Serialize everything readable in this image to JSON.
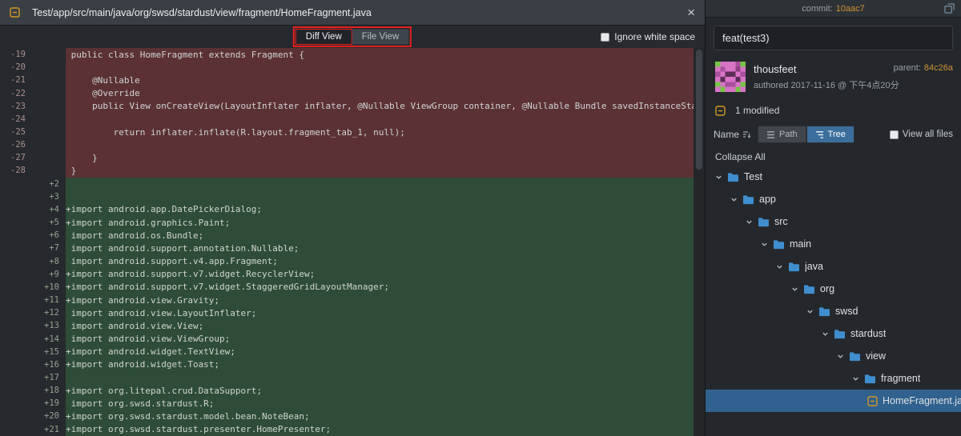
{
  "colors": {
    "header_bg": "#3a3f45",
    "panel_bg": "#26292d",
    "sidebar_bg": "#24282c",
    "sidebar_top_bg": "#2d3237",
    "del_bg": "#5b3134",
    "add_bg": "#2e4c37",
    "accent_blue": "#3f8ed0",
    "selected_blue": "#31618e",
    "hash_orange": "#cf9234",
    "mod_orange": "#d29922",
    "annotation_red": "#e5201d",
    "tree_btn_blue": "#3c6e9c"
  },
  "icons": {
    "modified_file_icon": "orange-square-with-dash",
    "close_icon": "×",
    "folder_icon": "blue-folder",
    "chevron_down_icon": "⌄",
    "sort_icon": "lines-with-down-arrow",
    "path_icon": "☰",
    "tree_icon": "☰",
    "expand_icon": "⧉",
    "checkbox_icon": "white-square"
  },
  "diff": {
    "file_path": "Test/app/src/main/java/org/swsd/stardust/view/fragment/HomeFragment.java",
    "close_label": "×",
    "toolbar": {
      "diff_view_label": "Diff View",
      "file_view_label": "File View",
      "ignore_whitespace_label": "Ignore white space"
    },
    "lines": [
      {
        "old": "-19",
        "new": "",
        "type": "del",
        "text": " public class HomeFragment extends Fragment {"
      },
      {
        "old": "-20",
        "new": "",
        "type": "del",
        "text": ""
      },
      {
        "old": "-21",
        "new": "",
        "type": "del",
        "text": "     @Nullable"
      },
      {
        "old": "-22",
        "new": "",
        "type": "del",
        "text": "     @Override"
      },
      {
        "old": "-23",
        "new": "",
        "type": "del",
        "text": "     public View onCreateView(LayoutInflater inflater, @Nullable ViewGroup container, @Nullable Bundle savedInstanceState) {"
      },
      {
        "old": "-24",
        "new": "",
        "type": "del",
        "text": ""
      },
      {
        "old": "-25",
        "new": "",
        "type": "del",
        "text": "         return inflater.inflate(R.layout.fragment_tab_1, null);"
      },
      {
        "old": "-26",
        "new": "",
        "type": "del",
        "text": ""
      },
      {
        "old": "-27",
        "new": "",
        "type": "del",
        "text": "     }"
      },
      {
        "old": "-28",
        "new": "",
        "type": "del",
        "text": " }"
      },
      {
        "old": "",
        "new": "+2",
        "type": "add",
        "text": ""
      },
      {
        "old": "",
        "new": "+3",
        "type": "add",
        "text": ""
      },
      {
        "old": "",
        "new": "+4",
        "type": "add",
        "text": "+import android.app.DatePickerDialog;"
      },
      {
        "old": "",
        "new": "+5",
        "type": "add",
        "text": "+import android.graphics.Paint;"
      },
      {
        "old": "",
        "new": "+6",
        "type": "add",
        "text": " import android.os.Bundle;"
      },
      {
        "old": "",
        "new": "+7",
        "type": "add",
        "text": " import android.support.annotation.Nullable;"
      },
      {
        "old": "",
        "new": "+8",
        "type": "add",
        "text": " import android.support.v4.app.Fragment;"
      },
      {
        "old": "",
        "new": "+9",
        "type": "add",
        "text": "+import android.support.v7.widget.RecyclerView;"
      },
      {
        "old": "",
        "new": "+10",
        "type": "add",
        "text": "+import android.support.v7.widget.StaggeredGridLayoutManager;"
      },
      {
        "old": "",
        "new": "+11",
        "type": "add",
        "text": "+import android.view.Gravity;"
      },
      {
        "old": "",
        "new": "+12",
        "type": "add",
        "text": " import android.view.LayoutInflater;"
      },
      {
        "old": "",
        "new": "+13",
        "type": "add",
        "text": " import android.view.View;"
      },
      {
        "old": "",
        "new": "+14",
        "type": "add",
        "text": " import android.view.ViewGroup;"
      },
      {
        "old": "",
        "new": "+15",
        "type": "add",
        "text": "+import android.widget.TextView;"
      },
      {
        "old": "",
        "new": "+16",
        "type": "add",
        "text": "+import android.widget.Toast;"
      },
      {
        "old": "",
        "new": "+17",
        "type": "add",
        "text": ""
      },
      {
        "old": "",
        "new": "+18",
        "type": "add",
        "text": "+import org.litepal.crud.DataSupport;"
      },
      {
        "old": "",
        "new": "+19",
        "type": "add",
        "text": " import org.swsd.stardust.R;"
      },
      {
        "old": "",
        "new": "+20",
        "type": "add",
        "text": "+import org.swsd.stardust.model.bean.NoteBean;"
      },
      {
        "old": "",
        "new": "+21",
        "type": "add",
        "text": "+import org.swsd.stardust.presenter.HomePresenter;"
      }
    ]
  },
  "sidebar": {
    "commit_label": "commit:",
    "commit_hash": "10aac7",
    "message": "feat(test3)",
    "author": {
      "name": "thousfeet",
      "authored": "authored 2017-11-16 @ 下午4点20分"
    },
    "parent_label": "parent:",
    "parent_hash": "84c26a",
    "modified_label": "1 modified",
    "controls": {
      "name_label": "Name",
      "path_label": "Path",
      "tree_label": "Tree",
      "view_all_label": "View all files"
    },
    "collapse_all_label": "Collapse All",
    "tree": [
      {
        "label": "Test",
        "level": 0,
        "type": "folder"
      },
      {
        "label": "app",
        "level": 1,
        "type": "folder"
      },
      {
        "label": "src",
        "level": 2,
        "type": "folder"
      },
      {
        "label": "main",
        "level": 3,
        "type": "folder"
      },
      {
        "label": "java",
        "level": 4,
        "type": "folder"
      },
      {
        "label": "org",
        "level": 5,
        "type": "folder"
      },
      {
        "label": "swsd",
        "level": 6,
        "type": "folder"
      },
      {
        "label": "stardust",
        "level": 7,
        "type": "folder"
      },
      {
        "label": "view",
        "level": 8,
        "type": "folder"
      },
      {
        "label": "fragment",
        "level": 9,
        "type": "folder"
      },
      {
        "label": "HomeFragment.java",
        "level": 10,
        "type": "file",
        "selected": true
      }
    ]
  }
}
